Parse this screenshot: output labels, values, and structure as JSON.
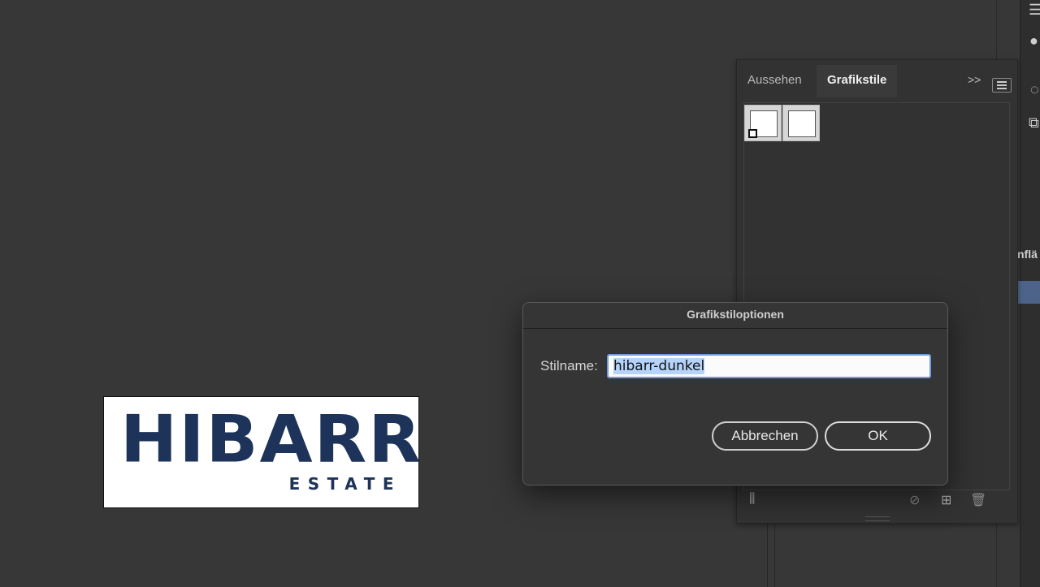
{
  "artboard": {
    "logo_main": "HIBARR",
    "logo_sub": "ESTATE",
    "brand_color": "#1d3359"
  },
  "right_strip": {
    "label": "nflä",
    "icons": [
      "menu-icon",
      "comment-icon",
      "sun-icon",
      "layers-icon"
    ]
  },
  "panel": {
    "tabs": [
      {
        "label": "Aussehen",
        "active": false
      },
      {
        "label": "Grafikstile",
        "active": true
      }
    ],
    "expand_label": ">>",
    "swatches": [
      "graphic-style-default",
      "graphic-style-2"
    ],
    "footer_icons": [
      "library-icon",
      "break-link-icon",
      "new-style-icon",
      "trash-icon"
    ]
  },
  "dialog": {
    "title": "Grafikstiloptionen",
    "field_label": "Stilname:",
    "field_value": "hibarr-dunkel",
    "cancel_label": "Abbrechen",
    "ok_label": "OK"
  },
  "colors": {
    "canvas": "#373737",
    "input_focus": "#6d9be0",
    "selection": "#b5d3fb"
  }
}
